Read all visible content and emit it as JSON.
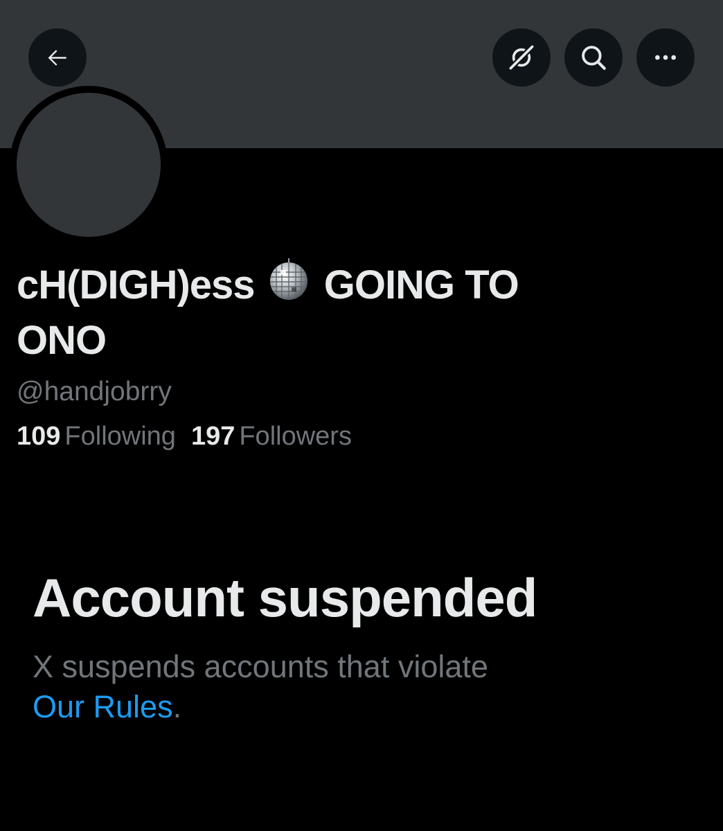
{
  "header": {
    "back_icon": "arrow-left-icon",
    "grok_icon": "grok-icon",
    "search_icon": "search-icon",
    "more_icon": "more-horizontal-icon",
    "button_background": "#0f1419",
    "banner_color": "#333639"
  },
  "profile": {
    "display_name_part1": "cH(DIGH)ess",
    "display_name_emoji": "mirror-ball-emoji",
    "display_name_part2": "GOING TO ONO",
    "handle": "@handjobrry",
    "following_count": "109",
    "following_label": "Following",
    "followers_count": "197",
    "followers_label": "Followers"
  },
  "suspension": {
    "title": "Account suspended",
    "description": "X suspends accounts that violate",
    "link_text": "Our Rules",
    "trailing_period": ".",
    "link_color": "#1d9bf0"
  },
  "colors": {
    "background": "#000000",
    "primary_text": "#e7e9ea",
    "secondary_text": "#71767b"
  }
}
